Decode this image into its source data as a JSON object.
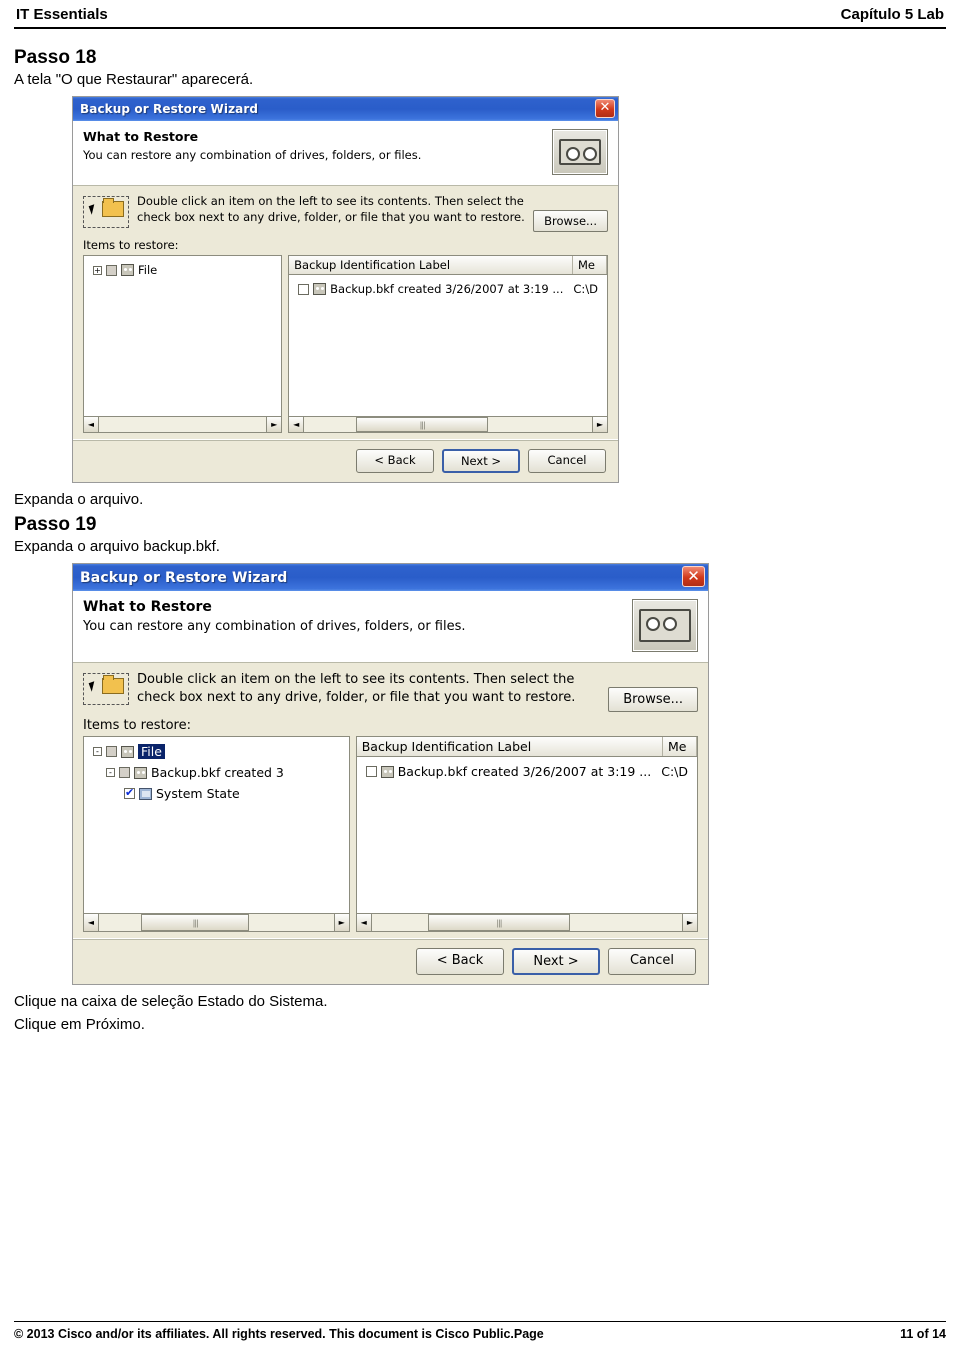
{
  "header": {
    "left": "IT Essentials",
    "right": "Capítulo 5 Lab"
  },
  "content": {
    "step18_title": "Passo 18",
    "step18_text": "A tela \"O que Restaurar\" aparecerá.",
    "after_shot1_text": "Expanda o arquivo.",
    "step19_title": "Passo 19",
    "step19_text": "Expanda o arquivo backup.bkf.",
    "after_shot2_text1": "Clique na caixa de seleção Estado do Sistema.",
    "after_shot2_text2": "Clique em Próximo."
  },
  "dialog1": {
    "title": "Backup or Restore Wizard",
    "close_label": "✕",
    "heading": "What to Restore",
    "subheading": "You can restore any combination of drives, folders, or files.",
    "instruction_line1": "Double click an item on the left to see its contents. Then select the",
    "instruction_line2": "check box next to any drive, folder, or file that you want to restore.",
    "browse_label": "Browse...",
    "items_label": "Items to restore:",
    "left_tree": [
      {
        "label": "File",
        "checked": false,
        "expander": "+",
        "icon": "tape-icon",
        "indent": 0,
        "selected": false
      }
    ],
    "right_columns": [
      "Backup Identification Label",
      "Me"
    ],
    "right_rows": [
      {
        "label": "Backup.bkf created 3/26/2007 at 3:19 ...",
        "media": "C:\\D",
        "checked": false
      }
    ],
    "buttons": {
      "back": "< Back",
      "next": "Next >",
      "cancel": "Cancel"
    }
  },
  "dialog2": {
    "title": "Backup or Restore Wizard",
    "close_label": "✕",
    "heading": "What to Restore",
    "subheading": "You can restore any combination of drives, folders, or files.",
    "instruction_line1": "Double click an item on the left to see its contents. Then select the",
    "instruction_line2": "check box next to any drive, folder, or file that you want to restore.",
    "browse_label": "Browse...",
    "items_label": "Items to restore:",
    "left_tree": [
      {
        "label": "File",
        "checked": false,
        "expander": "-",
        "icon": "tape-icon",
        "indent": 0,
        "selected": true
      },
      {
        "label": "Backup.bkf created 3",
        "checked": false,
        "expander": "-",
        "icon": "tape-icon",
        "indent": 1,
        "selected": false
      },
      {
        "label": "System State",
        "checked": true,
        "expander": "",
        "icon": "system-state-icon",
        "indent": 2,
        "selected": false
      }
    ],
    "right_columns": [
      "Backup Identification Label",
      "Me"
    ],
    "right_rows": [
      {
        "label": "Backup.bkf created 3/26/2007 at 3:19 ...",
        "media": "C:\\D",
        "checked": false
      }
    ],
    "buttons": {
      "back": "< Back",
      "next": "Next >",
      "cancel": "Cancel"
    }
  },
  "footer": {
    "copyright": "© 2013 Cisco and/or its affiliates. All rights reserved. This document is Cisco Public.Page",
    "page": "11 of 14"
  }
}
